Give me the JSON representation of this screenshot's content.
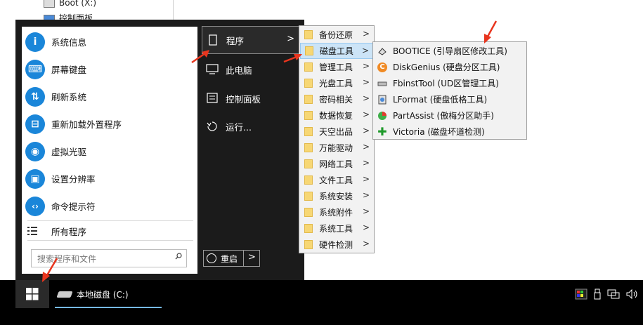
{
  "explorer": {
    "rows": [
      {
        "label": "Boot (X:)"
      },
      {
        "label": "控制面板"
      }
    ]
  },
  "start_menu": {
    "left_items": [
      {
        "label": "系统信息",
        "icon": "info-icon",
        "glyph": "i"
      },
      {
        "label": "屏幕键盘",
        "icon": "keyboard-icon",
        "glyph": "⌨"
      },
      {
        "label": "刷新系统",
        "icon": "refresh-icon",
        "glyph": "⇅"
      },
      {
        "label": "重新加载外置程序",
        "icon": "reload-icon",
        "glyph": "⊟"
      },
      {
        "label": "虚拟光驱",
        "icon": "disc-icon",
        "glyph": "◉"
      },
      {
        "label": "设置分辨率",
        "icon": "display-icon",
        "glyph": "▣"
      },
      {
        "label": "命令提示符",
        "icon": "code-icon",
        "glyph": "‹›"
      }
    ],
    "all_programs": "所有程序",
    "search_placeholder": "搜索程序和文件",
    "middle_items": [
      {
        "label": "程序",
        "icon": "program-icon"
      },
      {
        "label": "此电脑",
        "icon": "computer-icon"
      },
      {
        "label": "控制面板",
        "icon": "control-panel-icon"
      },
      {
        "label": "运行...",
        "icon": "run-icon"
      }
    ],
    "restart_label": "重启"
  },
  "program_submenu": {
    "items": [
      {
        "label": "备份还原"
      },
      {
        "label": "磁盘工具"
      },
      {
        "label": "管理工具"
      },
      {
        "label": "光盘工具"
      },
      {
        "label": "密码相关"
      },
      {
        "label": "数据恢复"
      },
      {
        "label": "天空出品"
      },
      {
        "label": "万能驱动"
      },
      {
        "label": "网络工具"
      },
      {
        "label": "文件工具"
      },
      {
        "label": "系统安装"
      },
      {
        "label": "系统附件"
      },
      {
        "label": "系统工具"
      },
      {
        "label": "硬件检测"
      }
    ],
    "active": "磁盘工具"
  },
  "disk_tools_submenu": {
    "items": [
      {
        "label": "BOOTICE (引导扇区修改工具)",
        "icon": "bootice-icon"
      },
      {
        "label": "DiskGenius (硬盘分区工具)",
        "icon": "diskgenius-icon"
      },
      {
        "label": "FbinstTool (UD区管理工具)",
        "icon": "fbinsttool-icon"
      },
      {
        "label": "LFormat (硬盘低格工具)",
        "icon": "lformat-icon"
      },
      {
        "label": "PartAssist (傲梅分区助手)",
        "icon": "partassist-icon"
      },
      {
        "label": "Victoria (磁盘坏道检测)",
        "icon": "victoria-icon"
      }
    ]
  },
  "taskbar": {
    "drive_label": "本地磁盘 (C:)"
  },
  "colors": {
    "accent": "#1a86d9",
    "menu_dark": "#1b1b1b",
    "highlight": "#cce4f7",
    "arrow": "#e8351e"
  }
}
